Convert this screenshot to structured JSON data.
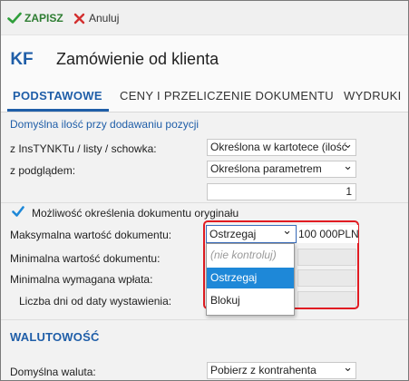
{
  "toolbar": {
    "save_label": "ZAPISZ",
    "cancel_label": "Anuluj",
    "save_icon": "check-icon",
    "cancel_icon": "close-icon",
    "save_color": "#2e7d32",
    "cancel_color": "#d32f2f"
  },
  "header": {
    "badge": "KF",
    "title": "Zamówienie od klienta"
  },
  "tabs": [
    {
      "label": "PODSTAWOWE",
      "active": true
    },
    {
      "label": "CENY I PRZELICZENIE DOKUMENTU",
      "active": false
    },
    {
      "label": "WYDRUKI",
      "active": false
    }
  ],
  "form": {
    "default_qty_link": "Domyślna ilość przy dodawaniu pozycji",
    "from_insert": {
      "label": "z InsTYNKTu / listy / schowka:",
      "value": "Określona w kartotece (ilość"
    },
    "with_preview": {
      "label": "z podglądem:",
      "value": "Określona parametrem"
    },
    "qty_param": {
      "value": "1"
    },
    "original_doc": {
      "label": "Możliwość określenia dokumentu oryginału",
      "checked": true
    },
    "max_value": {
      "label": "Maksymalna wartość dokumentu:",
      "mode": "Ostrzegaj",
      "amount": "100 000PLN"
    },
    "min_value": {
      "label": "Minimalna wartość dokumentu:"
    },
    "min_payment": {
      "label": "Minimalna wymagana wpłata:"
    },
    "days_from_issue": {
      "label": "Liczba dni od daty wystawienia:"
    },
    "mode_options": [
      {
        "label": "(nie kontroluj)",
        "selected": false
      },
      {
        "label": "Ostrzegaj",
        "selected": true
      },
      {
        "label": "Blokuj",
        "selected": false
      }
    ]
  },
  "currency": {
    "section_title": "WALUTOWOŚĆ",
    "default_currency": {
      "label": "Domyślna waluta:",
      "value": "Pobierz z kontrahenta"
    }
  },
  "colors": {
    "accent": "#1f5ea8",
    "highlight_border": "#e11b22",
    "selected_option": "#1e88d8"
  }
}
